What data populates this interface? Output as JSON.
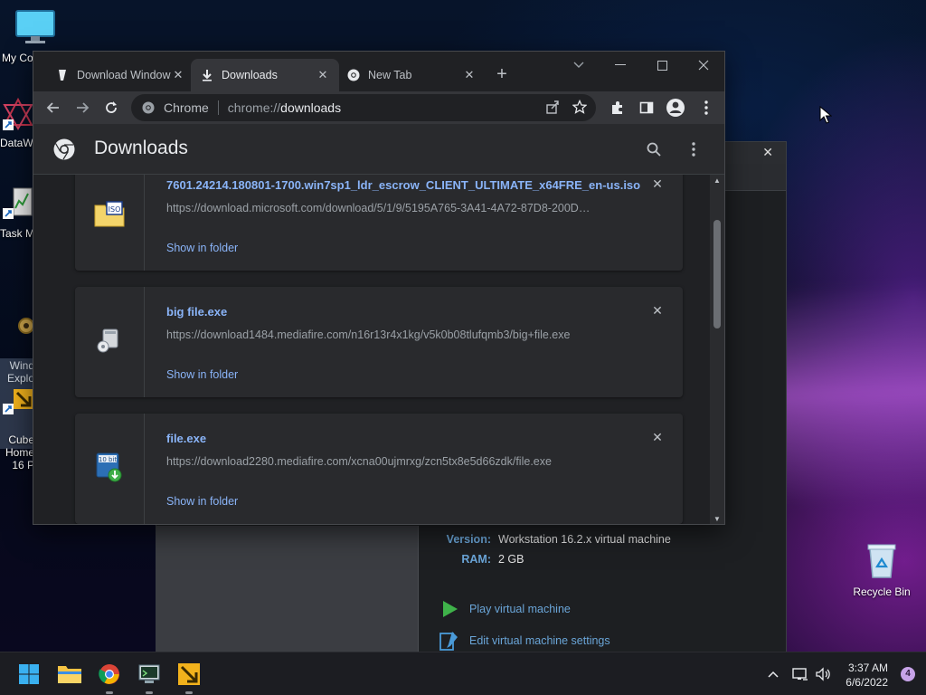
{
  "desktop": {
    "icons": [
      {
        "label": "My Co"
      },
      {
        "label": "DataW"
      },
      {
        "label": "Task M"
      },
      {
        "label": "Wind\nExplo"
      },
      {
        "label": "Cube\nHome\n16 P"
      },
      {
        "label": "Recycle Bin"
      }
    ]
  },
  "vmware": {
    "info": [
      {
        "key": "Version:",
        "value": "Workstation 16.2.x virtual machine"
      },
      {
        "key": "RAM:",
        "value": "2 GB"
      }
    ],
    "actions": [
      {
        "label": "Play virtual machine",
        "icon": "play-icon"
      },
      {
        "label": "Edit virtual machine settings",
        "icon": "settings-icon"
      }
    ]
  },
  "chrome": {
    "tabs": [
      {
        "title": "Download Windows",
        "icon": "page-icon"
      },
      {
        "title": "Downloads",
        "icon": "download-icon"
      },
      {
        "title": "New Tab",
        "icon": "chrome-icon"
      }
    ],
    "omnibox": {
      "chip": "Chrome",
      "scheme": "chrome://",
      "host": "downloads"
    },
    "page_title": "Downloads",
    "downloads": [
      {
        "filename": "7601.24214.180801-1700.win7sp1_ldr_escrow_CLIENT_ULTIMATE_x64FRE_en-us.iso",
        "url": "https://download.microsoft.com/download/5/1/9/5195A765-3A41-4A72-87D8-200D…",
        "action": "Show in folder",
        "icon": "iso-file-icon"
      },
      {
        "filename": "big file.exe",
        "url": "https://download1484.mediafire.com/n16r13r4x1kg/v5k0b08tlufqmb3/big+file.exe",
        "action": "Show in folder",
        "icon": "installer-icon"
      },
      {
        "filename": "file.exe",
        "url": "https://download2280.mediafire.com/xcna00ujmrxg/zcn5tx8e5d66zdk/file.exe",
        "action": "Show in folder",
        "icon": "setup-icon"
      }
    ]
  },
  "taskbar": {
    "time": "3:37 AM",
    "date": "6/6/2022",
    "notifications": "4"
  },
  "colors": {
    "link": "#8ab4f8",
    "surface": "#292a2d",
    "accent_vm": "#6aa5d8"
  }
}
